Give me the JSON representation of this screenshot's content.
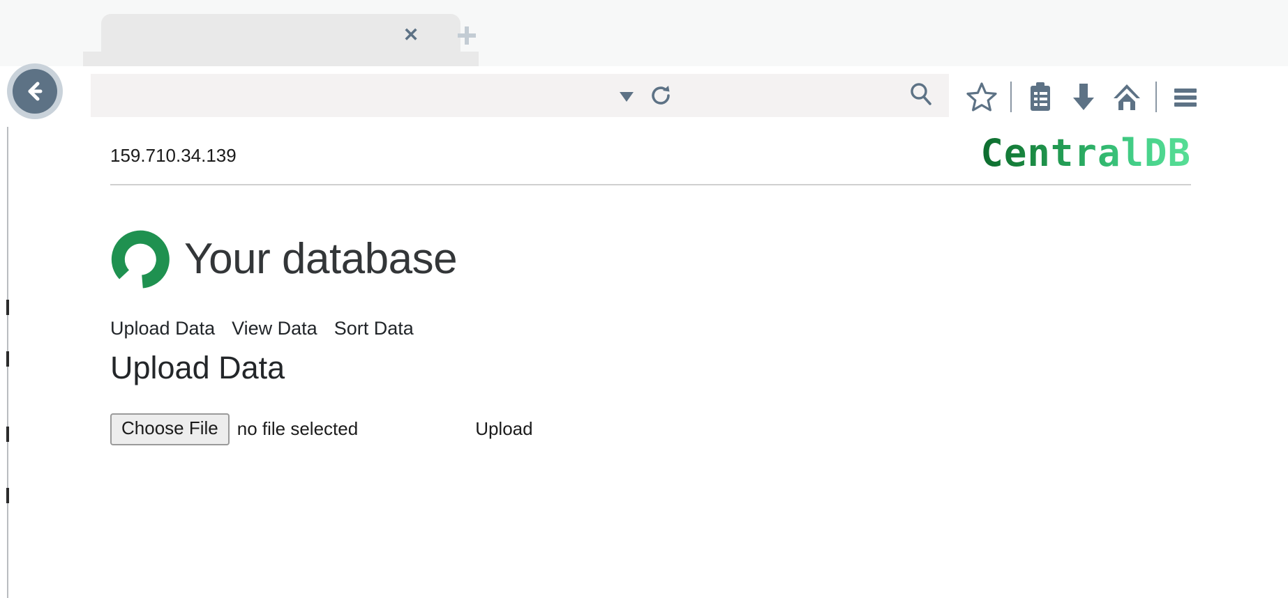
{
  "browser": {
    "tab": {
      "title": "",
      "close_label": "✕"
    },
    "new_tab_label": "+",
    "back_label": "Back",
    "url_value": "",
    "url_placeholder": "",
    "search_value": "",
    "search_placeholder": "",
    "toolbar_icons": [
      {
        "name": "bookmark-star-icon",
        "label": "Bookmark"
      },
      {
        "name": "reading-list-icon",
        "label": "Reading list"
      },
      {
        "name": "downloads-icon",
        "label": "Downloads"
      },
      {
        "name": "home-icon",
        "label": "Home"
      },
      {
        "name": "menu-icon",
        "label": "Menu"
      }
    ]
  },
  "site": {
    "ip_address": "159.710.34.139",
    "brand": "CentralDB",
    "hero_title": "Your database",
    "nav": [
      {
        "label": "Upload Data"
      },
      {
        "label": "View Data"
      },
      {
        "label": "Sort Data"
      }
    ],
    "page_heading": "Upload Data",
    "upload": {
      "choose_file_label": "Choose File",
      "file_status": "no file selected",
      "upload_label": "Upload"
    }
  },
  "colors": {
    "brand_green_dark": "#0d6b2e",
    "brand_green_light": "#58de96",
    "hero_mark_green": "#1f9150",
    "chrome_slate": "#5d7285",
    "tab_bg": "#e9e9e9",
    "urlbar_bg": "#f4f2f2"
  }
}
